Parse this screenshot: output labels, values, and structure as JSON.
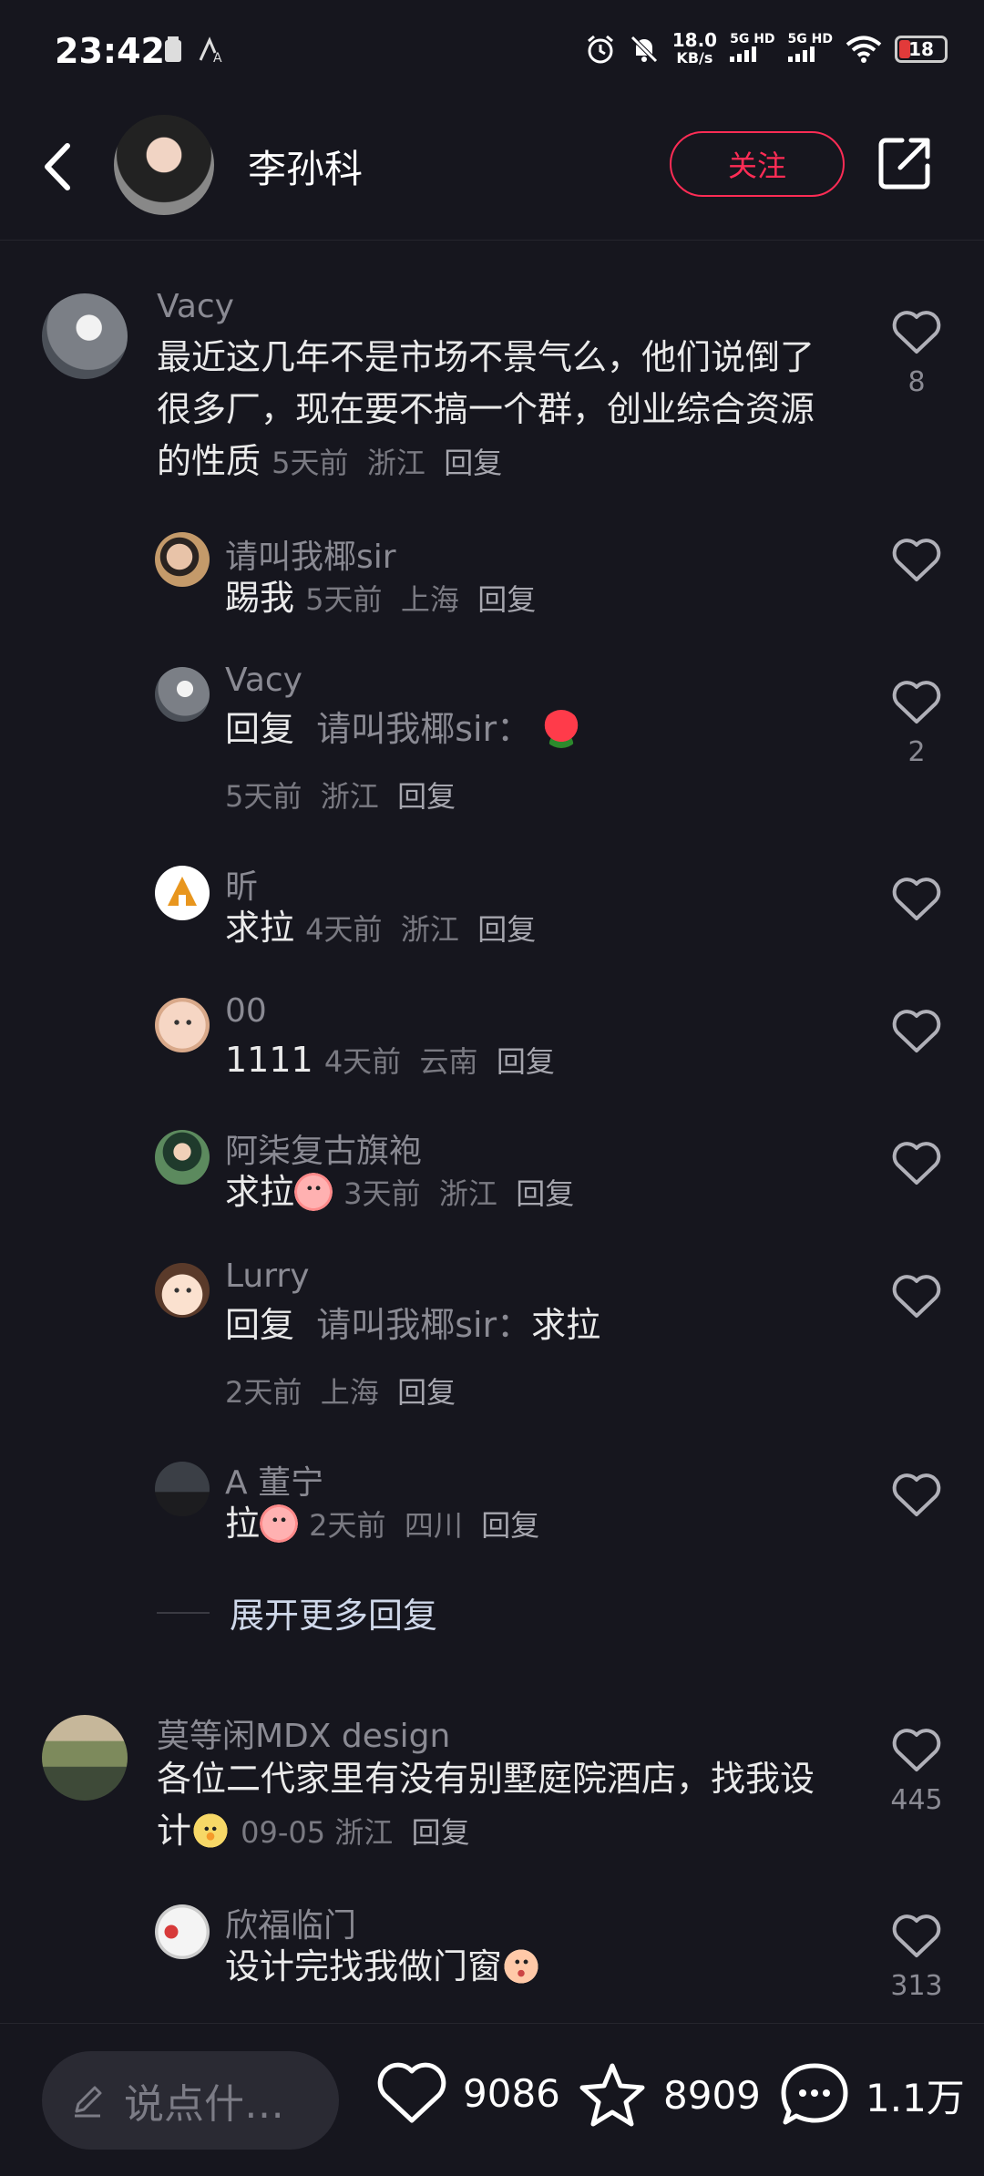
{
  "status_bar": {
    "time": "23:42",
    "speed": "18.0",
    "speed_unit": "KB/s",
    "net1": "5G HD",
    "net2": "5G HD",
    "battery": "18"
  },
  "header": {
    "author_name": "李孙科",
    "follow_label": "关注"
  },
  "comments": [
    {
      "user": "Vacy",
      "text": "最近这几年不是市场不景气么，他们说倒了很多厂，现在要不搞一个群，创业综合资源的性质",
      "time": "5天前",
      "location": "浙江",
      "reply_label": "回复",
      "likes": "8",
      "replies": [
        {
          "user": "请叫我椰sir",
          "text": "踢我",
          "time": "5天前",
          "location": "上海",
          "reply_label": "回复"
        },
        {
          "user": "Vacy",
          "prefix": "回复",
          "reply_to": "请叫我椰sir：",
          "text": "",
          "time": "5天前",
          "location": "浙江",
          "reply_label": "回复",
          "likes": "2",
          "emoji": "rose"
        },
        {
          "user": "昕",
          "text": "求拉",
          "time": "4天前",
          "location": "浙江",
          "reply_label": "回复"
        },
        {
          "user": "00",
          "text": "1111",
          "time": "4天前",
          "location": "云南",
          "reply_label": "回复"
        },
        {
          "user": "阿柒复古旗袍",
          "text": "求拉",
          "time": "3天前",
          "location": "浙江",
          "reply_label": "回复",
          "emoji": "chick"
        },
        {
          "user": "Lurry",
          "prefix": "回复",
          "reply_to": "请叫我椰sir：",
          "text": "求拉",
          "time": "2天前",
          "location": "上海",
          "reply_label": "回复"
        },
        {
          "user": "A 董宁",
          "text": "拉",
          "time": "2天前",
          "location": "四川",
          "reply_label": "回复",
          "emoji": "chick"
        }
      ],
      "expand_label": "展开更多回复"
    },
    {
      "user": "莫等闲MDX design",
      "text": "各位二代家里有没有别墅庭院酒店，找我设计",
      "time": "09-05",
      "location": "浙江",
      "reply_label": "回复",
      "likes": "445",
      "emoji": "bird",
      "replies": [
        {
          "user": "欣福临门",
          "text": "设计完找我做门窗",
          "likes": "313",
          "emoji": "face"
        }
      ]
    }
  ],
  "bottom_bar": {
    "input_placeholder": "说点什…",
    "likes": "9086",
    "favorites": "8909",
    "comments": "1.1万"
  },
  "colors": {
    "background": "#16161e",
    "accent": "#fe2c55"
  }
}
